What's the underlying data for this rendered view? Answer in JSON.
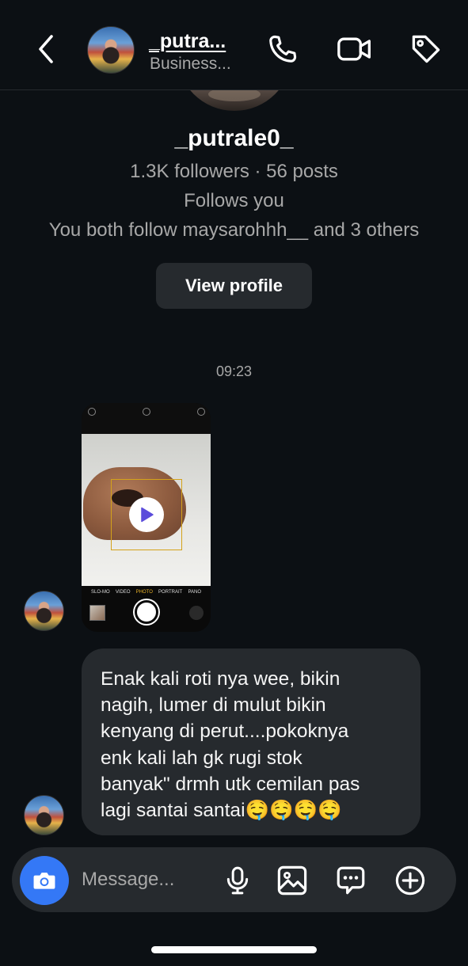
{
  "header": {
    "username": "_putra...",
    "subtitle": "Business..."
  },
  "profile": {
    "name": "_putrale0_",
    "stats": "1.3K followers · 56 posts",
    "follows_you": "Follows you",
    "mutuals": "You both follow maysarohhh__ and 3 others",
    "view_profile_label": "View profile"
  },
  "conversation": {
    "timestamp": "09:23",
    "video_message": {
      "camera_modes": [
        "SLO-MO",
        "VIDEO",
        "PHOTO",
        "PORTRAIT",
        "PANO"
      ],
      "active_mode": "PHOTO"
    },
    "text_message": "Enak kali roti nya wee, bikin\nnagih, lumer di mulut bikin\nkenyang di perut....pokoknya\nenk kali lah gk rugi stok\nbanyak\" drmh utk cemilan pas\nlagi santai santai🤤🤤🤤🤤"
  },
  "composer": {
    "placeholder": "Message..."
  },
  "colors": {
    "background": "#0c1014",
    "bubble": "#262a2e",
    "accent_camera": "#3478f6",
    "secondary_text": "#a8a8a8",
    "play_icon": "#5b4cdb"
  },
  "icons": {
    "header": [
      "chevron-left-icon",
      "phone-icon",
      "video-camera-icon",
      "tag-icon"
    ],
    "composer": [
      "camera-icon",
      "microphone-icon",
      "gallery-icon",
      "sticker-message-icon",
      "plus-circle-icon"
    ]
  }
}
